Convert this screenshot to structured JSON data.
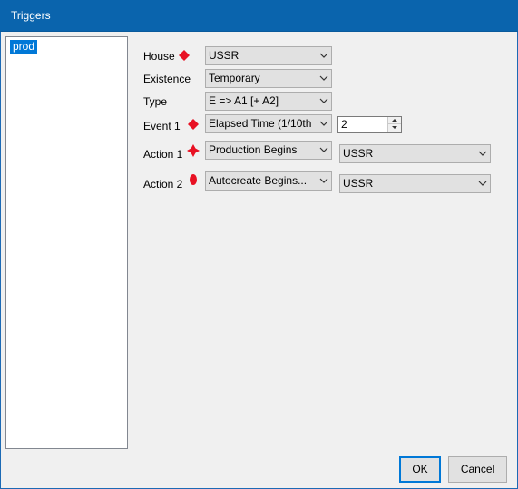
{
  "window": {
    "title": "Triggers"
  },
  "trigger_list": {
    "items": [
      {
        "label": "prod",
        "selected": true
      }
    ]
  },
  "form": {
    "house": {
      "label": "House",
      "value": "USSR"
    },
    "existence": {
      "label": "Existence",
      "value": "Temporary"
    },
    "type": {
      "label": "Type",
      "value": "E => A1 [+ A2]"
    },
    "event1": {
      "label": "Event 1",
      "value": "Elapsed Time (1/10th min",
      "param": "2"
    },
    "action1": {
      "label": "Action 1",
      "value": "Production Begins",
      "target": "USSR"
    },
    "action2": {
      "label": "Action 2",
      "value": "Autocreate Begins...",
      "target": "USSR"
    }
  },
  "buttons": {
    "ok": "OK",
    "cancel": "Cancel"
  },
  "colors": {
    "titlebar": "#0a64ad",
    "selection": "#0078d7",
    "marker": "#e81123"
  },
  "icons": {
    "marker": "red-diamond-icon",
    "dropdown": "chevron-down-icon"
  }
}
